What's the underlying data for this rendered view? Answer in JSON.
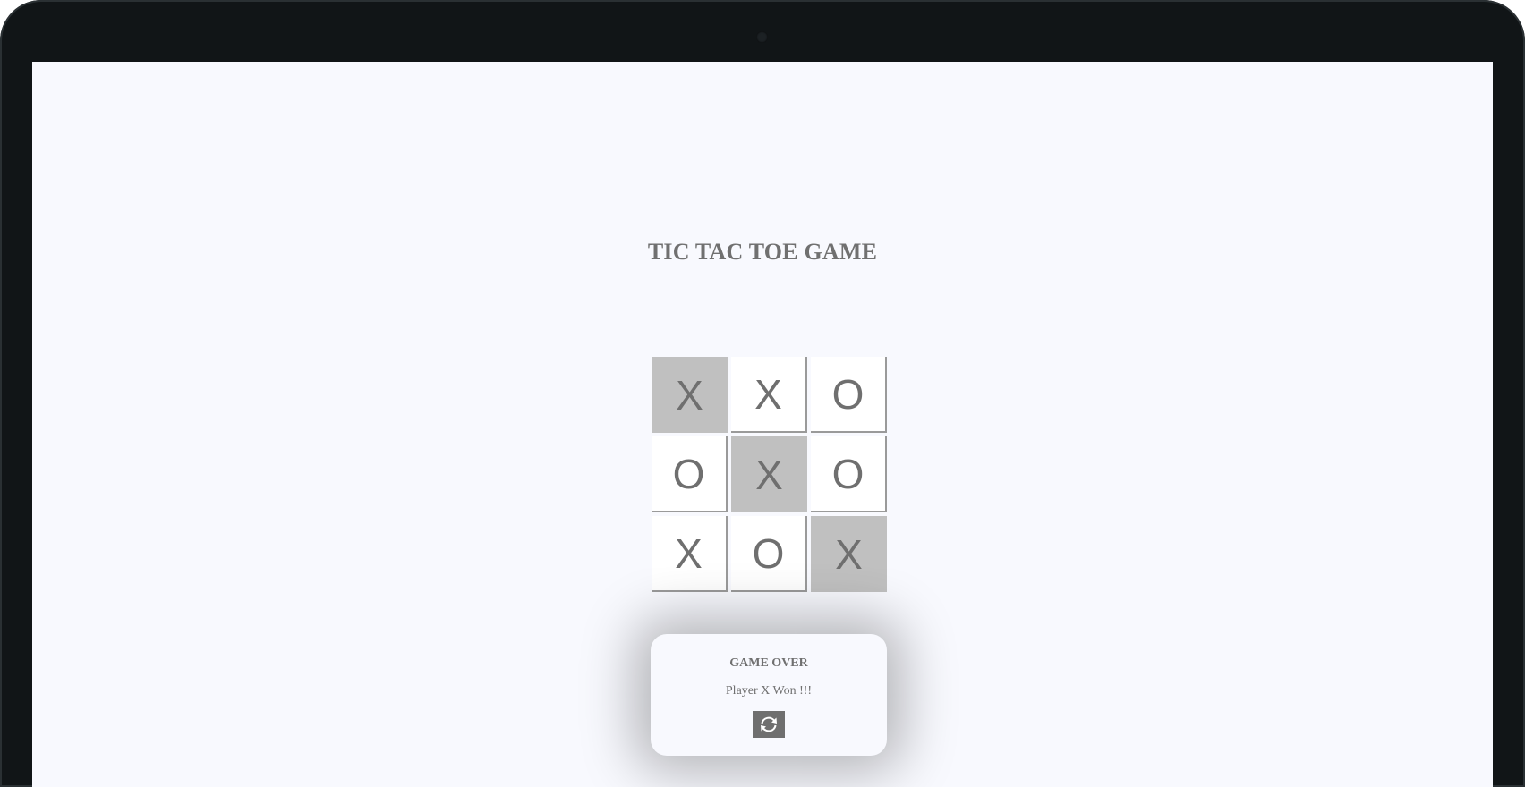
{
  "game": {
    "title": "TIC TAC TOE GAME",
    "board": {
      "cells": [
        "X",
        "X",
        "O",
        "O",
        "X",
        "O",
        "X",
        "O",
        "X"
      ],
      "winning_cells": [
        0,
        4,
        8
      ]
    },
    "popup": {
      "title": "GAME OVER",
      "message": "Player X Won !!!",
      "restart_icon": "refresh-icon"
    }
  },
  "colors": {
    "background": "#f8f9fe",
    "text": "#707070",
    "winning_cell": "#c0c0c0",
    "button": "#6f6f6f"
  }
}
